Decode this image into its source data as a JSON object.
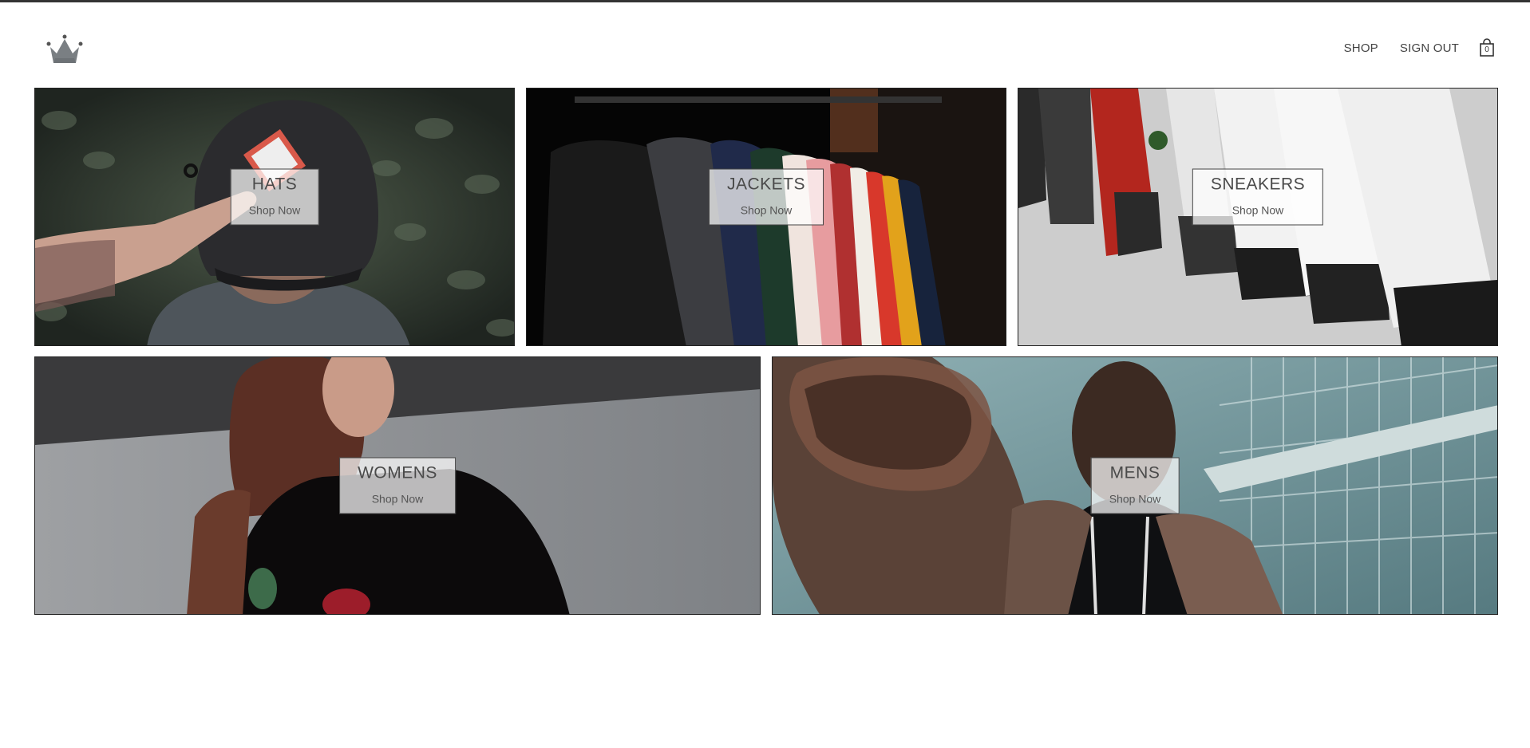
{
  "nav": {
    "shop": "SHOP",
    "sign_out": "SIGN OUT",
    "cart_count": "0"
  },
  "icons": {
    "logo": "crown-icon",
    "cart": "shopping-bag-icon"
  },
  "categories": [
    {
      "title": "HATS",
      "cta": "Shop Now"
    },
    {
      "title": "JACKETS",
      "cta": "Shop Now"
    },
    {
      "title": "SNEAKERS",
      "cta": "Shop Now"
    },
    {
      "title": "WOMENS",
      "cta": "Shop Now"
    },
    {
      "title": "MENS",
      "cta": "Shop Now"
    }
  ]
}
